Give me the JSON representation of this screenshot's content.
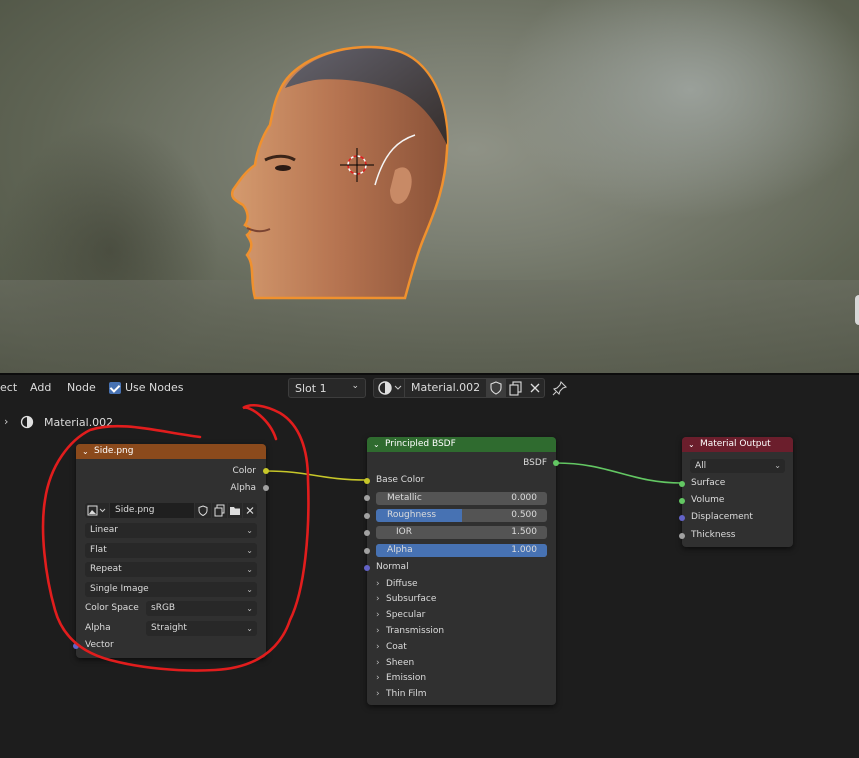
{
  "header": {
    "menu_partial": "ect",
    "menu_add": "Add",
    "menu_node": "Node",
    "use_nodes_label": "Use Nodes",
    "slot_value": "Slot 1",
    "material_name": "Material.002"
  },
  "breadcrumb": {
    "material": "Material.002"
  },
  "image_node": {
    "title": "Side.png",
    "outputs": [
      "Color",
      "Alpha"
    ],
    "image_name": "Side.png",
    "interpolation": "Linear",
    "projection": "Flat",
    "extension": "Repeat",
    "source": "Single Image",
    "color_space_label": "Color Space",
    "color_space_value": "sRGB",
    "alpha_label": "Alpha",
    "alpha_value": "Straight",
    "input_vector": "Vector",
    "header_color": "#8b4a1c"
  },
  "bsdf_node": {
    "title": "Principled BSDF",
    "output": "BSDF",
    "base_color": "Base Color",
    "fields": [
      {
        "name": "Metallic",
        "value": "0.000",
        "fraction": 0.0
      },
      {
        "name": "Roughness",
        "value": "0.500",
        "fraction": 0.5
      },
      {
        "name": "IOR",
        "value": "1.500",
        "fraction": 0.0
      },
      {
        "name": "Alpha",
        "value": "1.000",
        "fraction": 1.0
      }
    ],
    "normal": "Normal",
    "panels": [
      "Diffuse",
      "Subsurface",
      "Specular",
      "Transmission",
      "Coat",
      "Sheen",
      "Emission",
      "Thin Film"
    ],
    "header_color": "#2f6b2f"
  },
  "output_node": {
    "title": "Material Output",
    "target": "All",
    "inputs": [
      "Surface",
      "Volume",
      "Displacement",
      "Thickness"
    ],
    "header_color": "#6b1e2c"
  },
  "colors": {
    "accent": "#4772b3",
    "annotation": "#e11d1d",
    "socket_yellow": "#c7c729",
    "socket_green": "#63c763",
    "socket_grey": "#a1a1a1",
    "socket_purple": "#6363c7"
  }
}
